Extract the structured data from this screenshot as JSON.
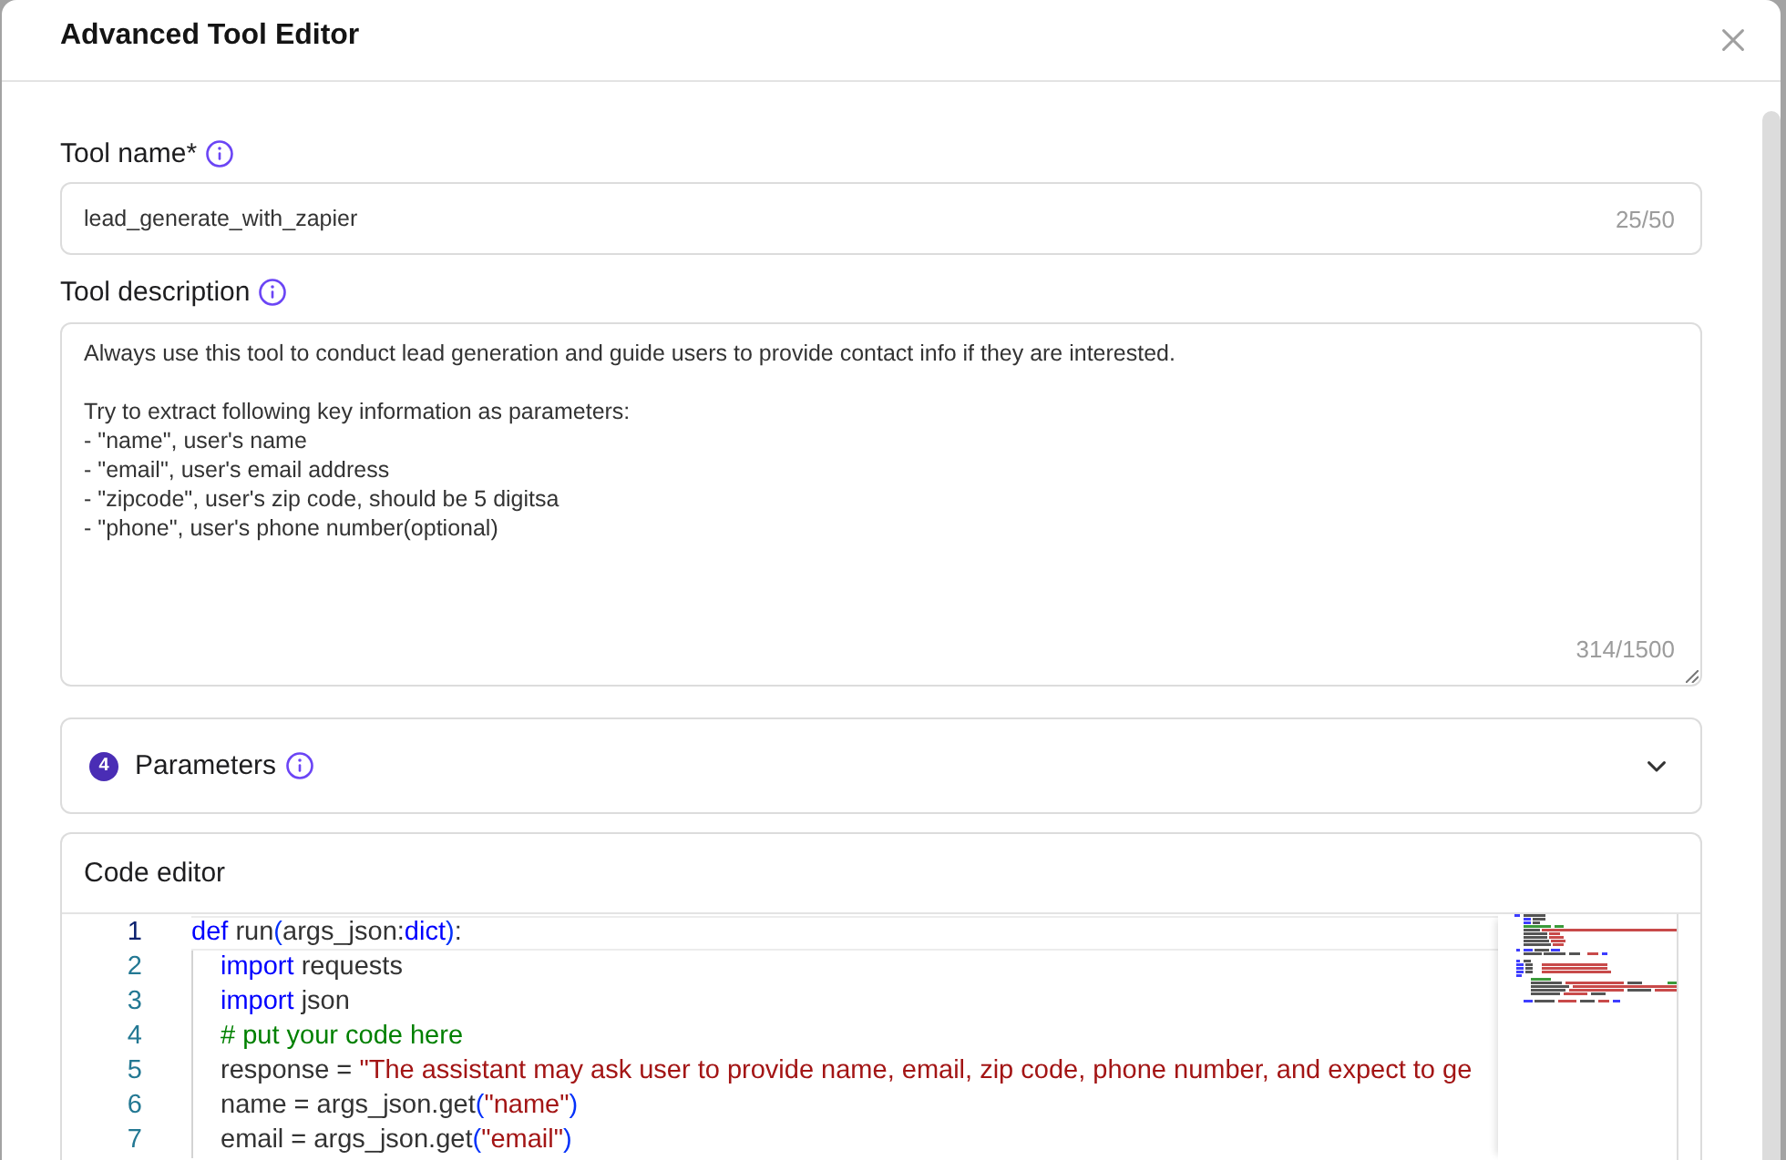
{
  "dialog": {
    "title": "Advanced Tool Editor"
  },
  "tool_name": {
    "label": "Tool name*",
    "value": "lead_generate_with_zapier",
    "counter": "25/50"
  },
  "tool_description": {
    "label": "Tool description",
    "value": "Always use this tool to conduct lead generation and guide users to provide contact info if they are interested.\n\nTry to extract following key information as parameters:\n- \"name\", user's name\n- \"email\", user's email address\n- \"zipcode\", user's zip code, should be 5 digitsa\n- \"phone\", user's phone number(optional)",
    "counter": "314/1500"
  },
  "parameters": {
    "count": "4",
    "label": "Parameters",
    "expanded": false
  },
  "code_editor": {
    "title": "Code editor",
    "lines": [
      {
        "number": "1",
        "current": true,
        "tokens": [
          {
            "kind": "keyword",
            "text": "def"
          },
          {
            "kind": "plain",
            "text": " run"
          },
          {
            "kind": "bracket",
            "text": "("
          },
          {
            "kind": "plain",
            "text": "args_json:"
          },
          {
            "kind": "keyword",
            "text": "dict"
          },
          {
            "kind": "bracket",
            "text": ")"
          },
          {
            "kind": "plain",
            "text": ":"
          }
        ],
        "children": [
          {
            "number": "2",
            "current": false,
            "tokens": [
              {
                "kind": "keyword",
                "text": "import"
              },
              {
                "kind": "plain",
                "text": " requests"
              }
            ]
          },
          {
            "number": "3",
            "current": false,
            "tokens": [
              {
                "kind": "keyword",
                "text": "import"
              },
              {
                "kind": "plain",
                "text": " json"
              }
            ]
          },
          {
            "number": "4",
            "current": false,
            "tokens": [
              {
                "kind": "comment",
                "text": "# put your code here"
              }
            ]
          },
          {
            "number": "5",
            "current": false,
            "tokens": [
              {
                "kind": "plain",
                "text": "response = "
              },
              {
                "kind": "string",
                "text": "\"The assistant may ask user to provide name, email, zip code, phone number, and expect to ge"
              }
            ]
          },
          {
            "number": "6",
            "current": false,
            "tokens": [
              {
                "kind": "plain",
                "text": "name = args_json.get"
              },
              {
                "kind": "bracket",
                "text": "("
              },
              {
                "kind": "string",
                "text": "\"name\""
              },
              {
                "kind": "bracket",
                "text": ")"
              }
            ]
          },
          {
            "number": "7",
            "current": false,
            "tokens": [
              {
                "kind": "plain",
                "text": "email = args_json.get"
              },
              {
                "kind": "bracket",
                "text": "("
              },
              {
                "kind": "string",
                "text": "\"email\""
              },
              {
                "kind": "bracket",
                "text": ")"
              }
            ]
          }
        ]
      }
    ]
  }
}
